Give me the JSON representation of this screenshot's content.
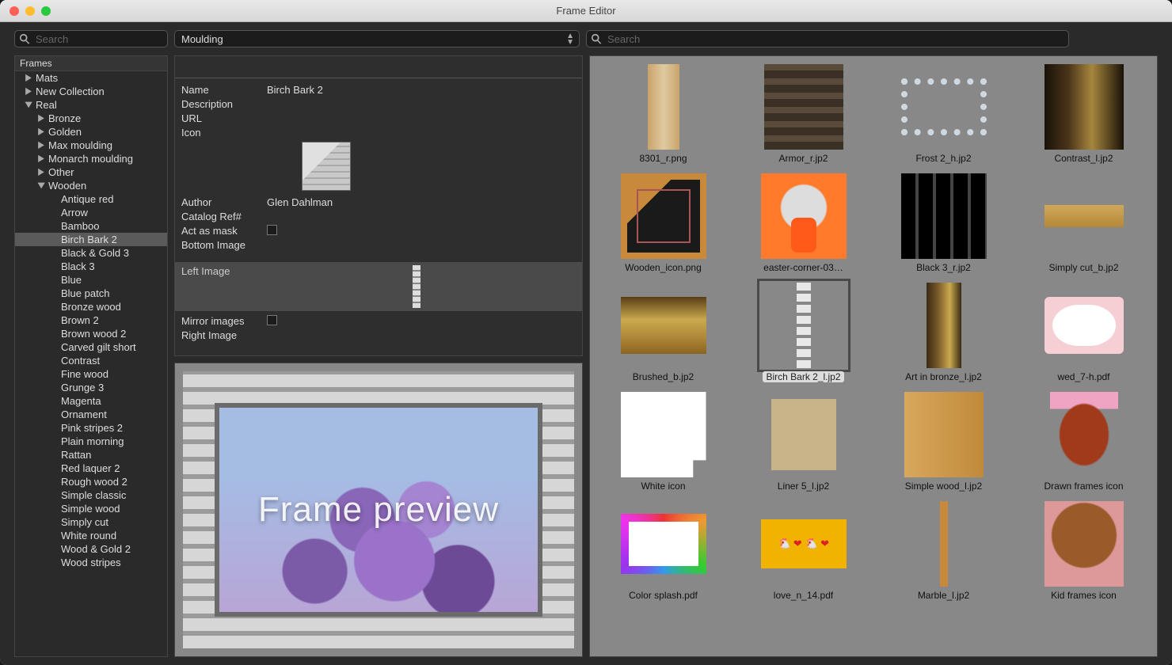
{
  "window": {
    "title": "Frame Editor"
  },
  "toolbar": {
    "search_left_placeholder": "Search",
    "dropdown_value": "Moulding",
    "search_right_placeholder": "Search"
  },
  "sidebar": {
    "header": "Frames",
    "tree": [
      {
        "label": "Mats",
        "depth": 0,
        "caret": "closed"
      },
      {
        "label": "New Collection",
        "depth": 0,
        "caret": "closed"
      },
      {
        "label": "Real",
        "depth": 0,
        "caret": "open"
      },
      {
        "label": "Bronze",
        "depth": 1,
        "caret": "closed"
      },
      {
        "label": "Golden",
        "depth": 1,
        "caret": "closed"
      },
      {
        "label": "Max moulding",
        "depth": 1,
        "caret": "closed"
      },
      {
        "label": "Monarch moulding",
        "depth": 1,
        "caret": "closed"
      },
      {
        "label": "Other",
        "depth": 1,
        "caret": "closed"
      },
      {
        "label": "Wooden",
        "depth": 1,
        "caret": "open"
      },
      {
        "label": "Antique red",
        "depth": 2,
        "caret": "none"
      },
      {
        "label": "Arrow",
        "depth": 2,
        "caret": "none"
      },
      {
        "label": "Bamboo",
        "depth": 2,
        "caret": "none"
      },
      {
        "label": "Birch Bark 2",
        "depth": 2,
        "caret": "none",
        "selected": true
      },
      {
        "label": "Black & Gold 3",
        "depth": 2,
        "caret": "none"
      },
      {
        "label": "Black 3",
        "depth": 2,
        "caret": "none"
      },
      {
        "label": "Blue",
        "depth": 2,
        "caret": "none"
      },
      {
        "label": "Blue patch",
        "depth": 2,
        "caret": "none"
      },
      {
        "label": "Bronze wood",
        "depth": 2,
        "caret": "none"
      },
      {
        "label": "Brown 2",
        "depth": 2,
        "caret": "none"
      },
      {
        "label": "Brown wood 2",
        "depth": 2,
        "caret": "none"
      },
      {
        "label": "Carved gilt short",
        "depth": 2,
        "caret": "none"
      },
      {
        "label": "Contrast",
        "depth": 2,
        "caret": "none"
      },
      {
        "label": "Fine wood",
        "depth": 2,
        "caret": "none"
      },
      {
        "label": "Grunge 3",
        "depth": 2,
        "caret": "none"
      },
      {
        "label": "Magenta",
        "depth": 2,
        "caret": "none"
      },
      {
        "label": "Ornament",
        "depth": 2,
        "caret": "none"
      },
      {
        "label": "Pink stripes 2",
        "depth": 2,
        "caret": "none"
      },
      {
        "label": "Plain morning",
        "depth": 2,
        "caret": "none"
      },
      {
        "label": "Rattan",
        "depth": 2,
        "caret": "none"
      },
      {
        "label": "Red laquer 2",
        "depth": 2,
        "caret": "none"
      },
      {
        "label": "Rough wood 2",
        "depth": 2,
        "caret": "none"
      },
      {
        "label": "Simple classic",
        "depth": 2,
        "caret": "none"
      },
      {
        "label": "Simple wood",
        "depth": 2,
        "caret": "none"
      },
      {
        "label": "Simply cut",
        "depth": 2,
        "caret": "none"
      },
      {
        "label": "White round",
        "depth": 2,
        "caret": "none"
      },
      {
        "label": "Wood & Gold 2",
        "depth": 2,
        "caret": "none"
      },
      {
        "label": "Wood stripes",
        "depth": 2,
        "caret": "none"
      }
    ]
  },
  "properties": {
    "labels": {
      "name": "Name",
      "description": "Description",
      "url": "URL",
      "icon": "Icon",
      "author": "Author",
      "catalog": "Catalog Ref#",
      "actasmask": "Act as mask",
      "bottomimage": "Bottom Image",
      "leftimage": "Left Image",
      "mirror": "Mirror images",
      "rightimage": "Right Image"
    },
    "values": {
      "name": "Birch Bark 2",
      "description": "",
      "url": "",
      "author": "Glen Dahlman",
      "catalog": "",
      "actasmask": false,
      "mirror": false
    }
  },
  "preview": {
    "label": "Frame preview"
  },
  "gallery": {
    "items": [
      {
        "label": "8301_r.png",
        "swatch": "sw-8301"
      },
      {
        "label": "Armor_r.jp2",
        "swatch": "sw-armor"
      },
      {
        "label": "Frost 2_h.jp2",
        "swatch": "sw-frost"
      },
      {
        "label": "Contrast_l.jp2",
        "swatch": "sw-contrast"
      },
      {
        "label": "Wooden_icon.png",
        "swatch": "sw-woodicon"
      },
      {
        "label": "easter-corner-03…",
        "swatch": "sw-easter"
      },
      {
        "label": "Black 3_r.jp2",
        "swatch": "sw-black3"
      },
      {
        "label": "Simply cut_b.jp2",
        "swatch": "sw-simplycut"
      },
      {
        "label": "Brushed_b.jp2",
        "swatch": "sw-brushed"
      },
      {
        "label": "Birch Bark 2_l.jp2",
        "swatch": "sw-birch",
        "selected": true
      },
      {
        "label": "Art in bronze_l.jp2",
        "swatch": "sw-artbronze"
      },
      {
        "label": "wed_7-h.pdf",
        "swatch": "sw-wed7"
      },
      {
        "label": "White icon",
        "swatch": "sw-whiteicon"
      },
      {
        "label": "Liner 5_l.jp2",
        "swatch": "sw-liner5"
      },
      {
        "label": "Simple wood_l.jp2",
        "swatch": "sw-simplewood"
      },
      {
        "label": "Drawn frames icon",
        "swatch": "sw-drawn"
      },
      {
        "label": "Color splash.pdf",
        "swatch": "sw-colorsplash"
      },
      {
        "label": "love_n_14.pdf",
        "swatch": "sw-love"
      },
      {
        "label": "Marble_l.jp2",
        "swatch": "sw-marble"
      },
      {
        "label": "Kid frames icon",
        "swatch": "sw-kid"
      }
    ]
  }
}
